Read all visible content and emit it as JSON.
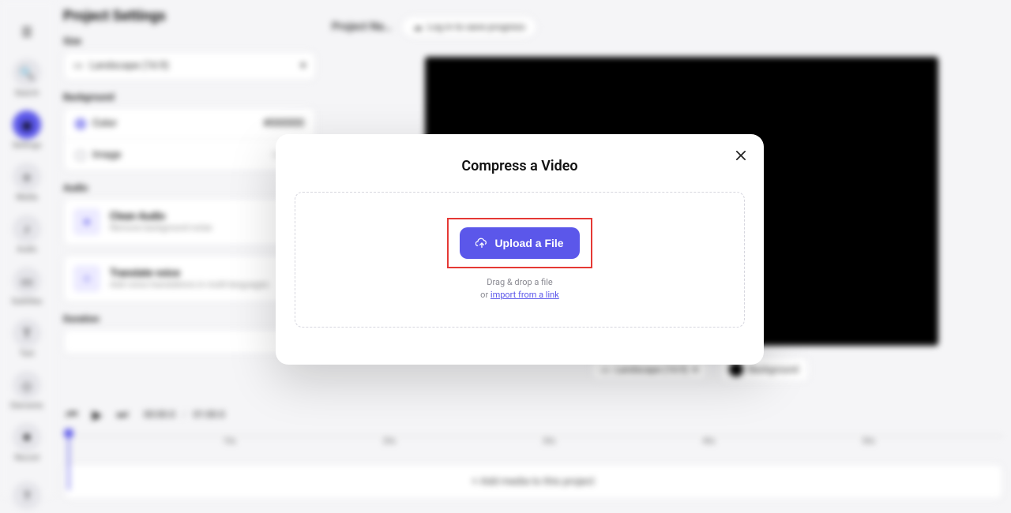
{
  "sidebar": {
    "items": [
      {
        "label": ""
      },
      {
        "label": "Search"
      },
      {
        "label": "Settings"
      },
      {
        "label": "Media"
      },
      {
        "label": "Audio"
      },
      {
        "label": "Subtitles"
      },
      {
        "label": "Text"
      },
      {
        "label": "Elements"
      },
      {
        "label": "Record"
      }
    ]
  },
  "settings": {
    "title": "Project Settings",
    "size_label": "Size",
    "size_value": "Landscape (16:9)",
    "background_label": "Background",
    "bg_color_label": "Color",
    "bg_color_value": "#000000",
    "bg_image_label": "Image",
    "bg_image_action": "Upload",
    "audio_label": "Audio",
    "clean_audio_title": "Clean Audio",
    "clean_audio_sub": "Remove background noise",
    "translate_title": "Translate voice",
    "translate_sub": "Add voice translations in multi-languages",
    "duration_label": "Duration"
  },
  "topbar": {
    "project_name": "Project Na…",
    "login_label": "Log in to save progress"
  },
  "under_preview": {
    "aspect_label": "Landscape (16:9)",
    "bg_label": "Background"
  },
  "transport": {
    "current": "00:00.0",
    "separator": "/",
    "total": "01:00.0"
  },
  "timeline": {
    "ticks": [
      "",
      "10s",
      "20s",
      "30s",
      "40s",
      "50s"
    ],
    "add_media": "+  Add media to this project"
  },
  "modal": {
    "title": "Compress a Video",
    "upload_label": "Upload a File",
    "hint_line1": "Drag & drop a file",
    "hint_or": "or ",
    "hint_link": "import from a link"
  }
}
